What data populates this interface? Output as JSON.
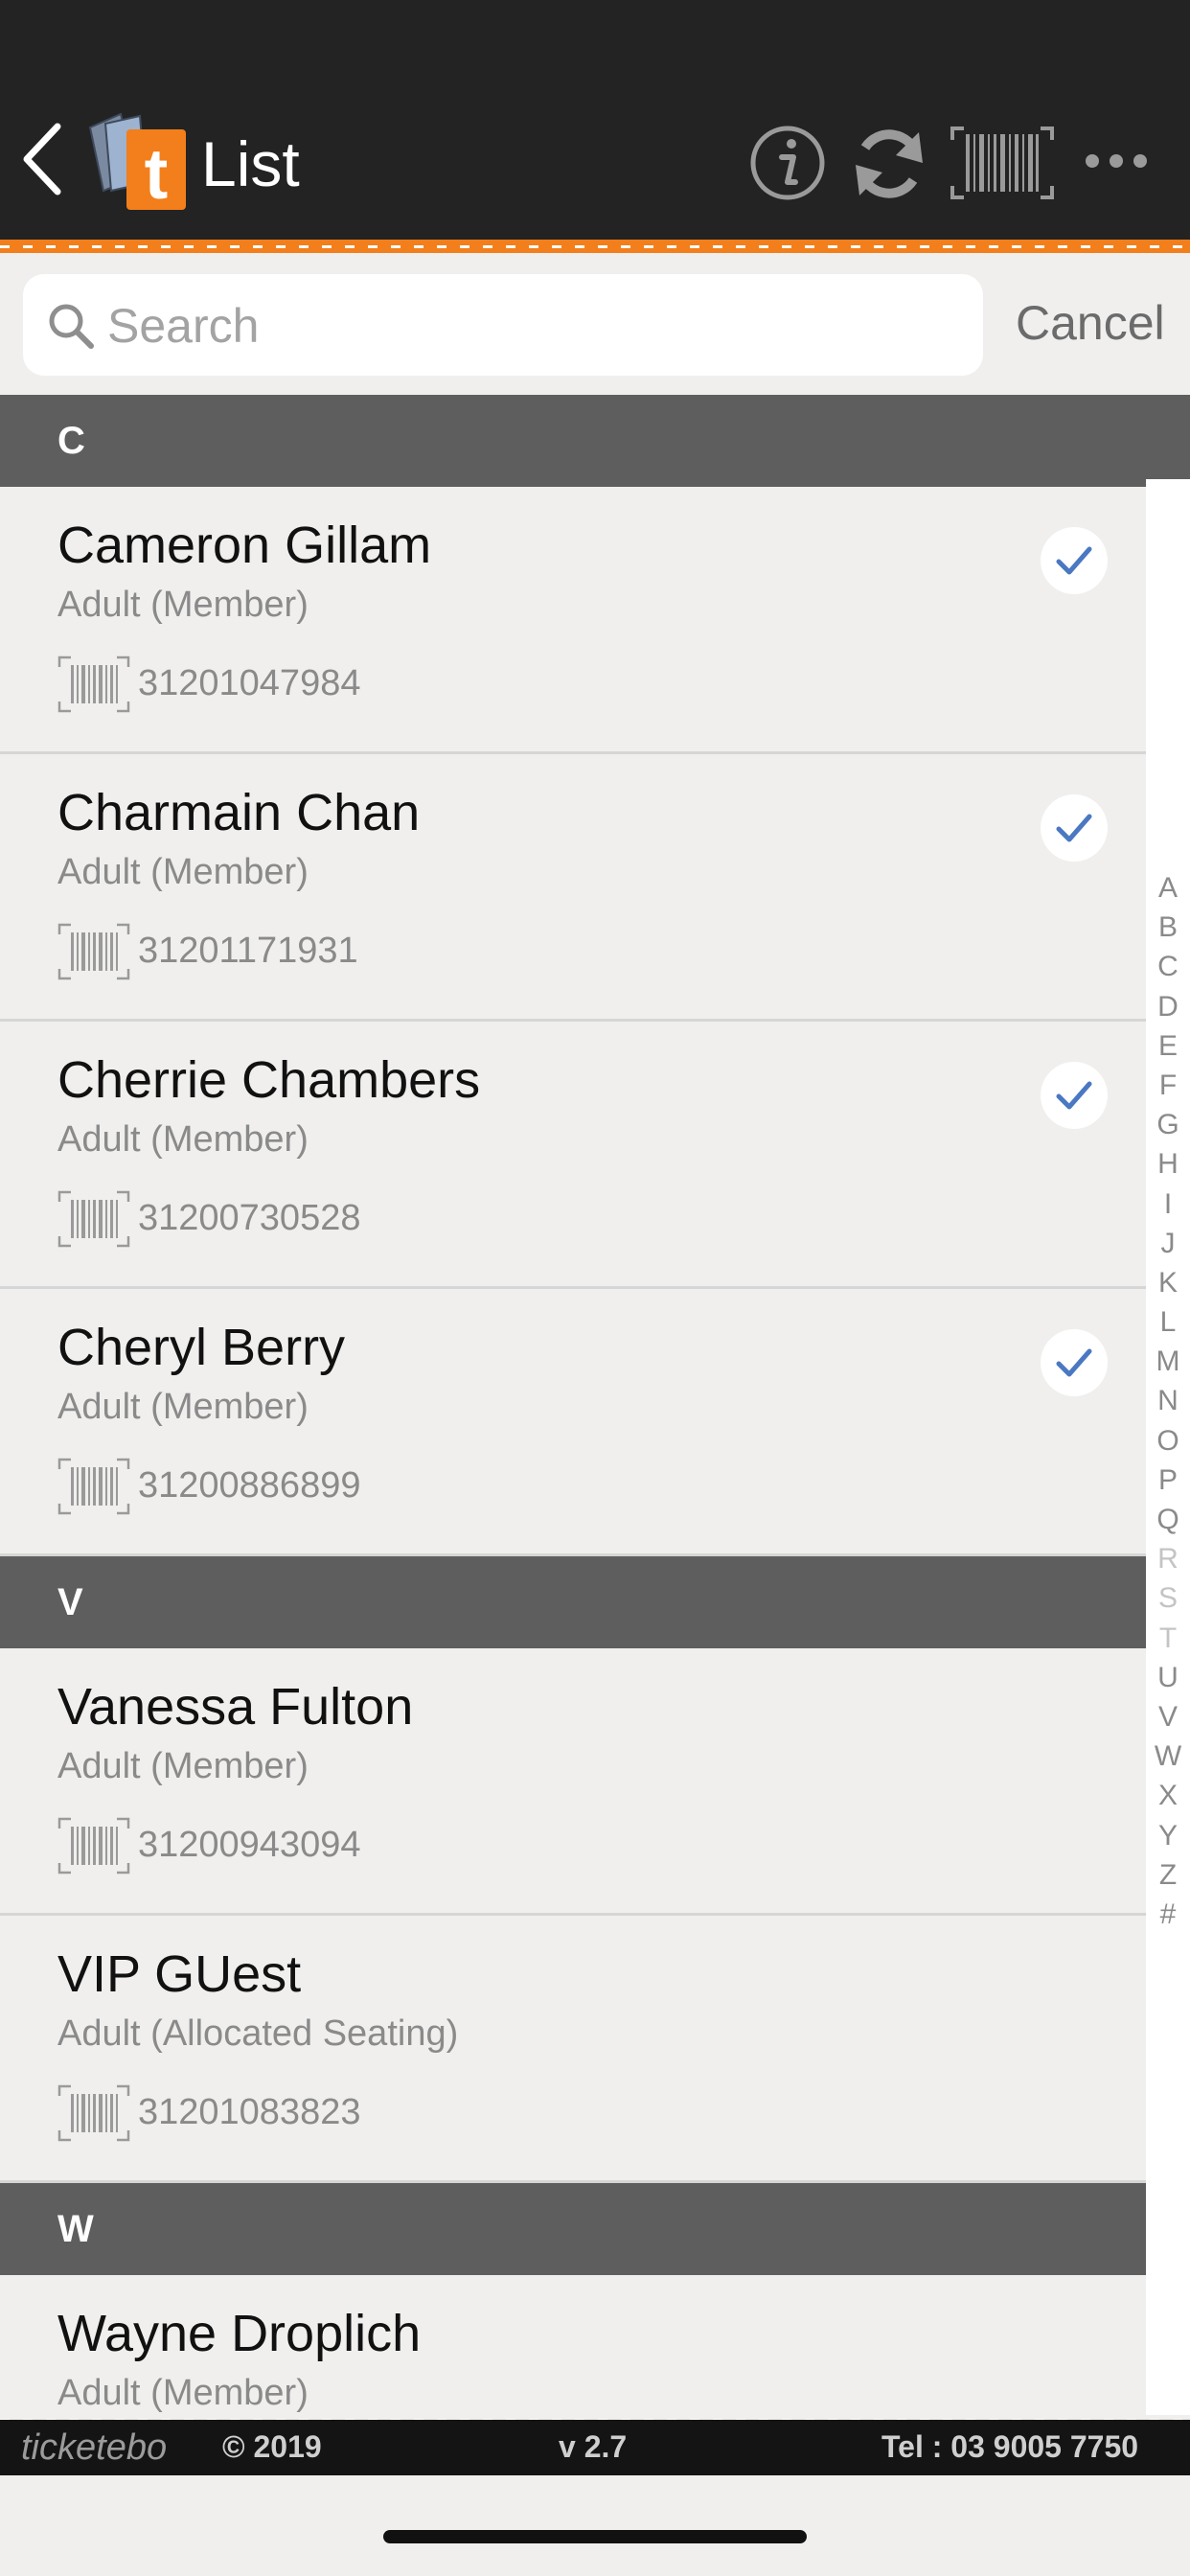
{
  "header": {
    "title": "List"
  },
  "search": {
    "placeholder": "Search",
    "value": "",
    "cancel_label": "Cancel"
  },
  "sections": [
    {
      "letter": "C",
      "items": [
        {
          "name": "Cameron Gillam",
          "type": "Adult (Member)",
          "code": "31201047984",
          "checked": true
        },
        {
          "name": "Charmain Chan",
          "type": "Adult (Member)",
          "code": "31201171931",
          "checked": true
        },
        {
          "name": "Cherrie Chambers",
          "type": "Adult (Member)",
          "code": "31200730528",
          "checked": true
        },
        {
          "name": "Cheryl Berry",
          "type": "Adult (Member)",
          "code": "31200886899",
          "checked": true
        }
      ]
    },
    {
      "letter": "V",
      "items": [
        {
          "name": "Vanessa Fulton",
          "type": "Adult (Member)",
          "code": "31200943094",
          "checked": false
        },
        {
          "name": "VIP GUest",
          "type": "Adult (Allocated Seating)",
          "code": "31201083823",
          "checked": false
        }
      ]
    },
    {
      "letter": "W",
      "items": [
        {
          "name": "Wayne Droplich",
          "type": "Adult (Member)",
          "code": "",
          "checked": false
        }
      ]
    }
  ],
  "alphabet_index": [
    "A",
    "B",
    "C",
    "D",
    "E",
    "F",
    "G",
    "H",
    "I",
    "J",
    "K",
    "L",
    "M",
    "N",
    "O",
    "P",
    "Q",
    "R",
    "S",
    "T",
    "U",
    "V",
    "W",
    "X",
    "Y",
    "Z",
    "#"
  ],
  "footer": {
    "brand": "ticketebo",
    "copyright": "© 2019",
    "version": "v 2.7",
    "tel": "Tel : 03 9005 7750"
  },
  "colors": {
    "header_bg": "#232323",
    "accent": "#f27f1b",
    "section_bg": "#5e5e5e",
    "check": "#4a78c2"
  },
  "icons": [
    "back-icon",
    "ticketebo-logo",
    "info-icon",
    "refresh-icon",
    "barcode-scan-icon",
    "more-icon",
    "search-icon",
    "barcode-icon",
    "checkmark-icon"
  ]
}
